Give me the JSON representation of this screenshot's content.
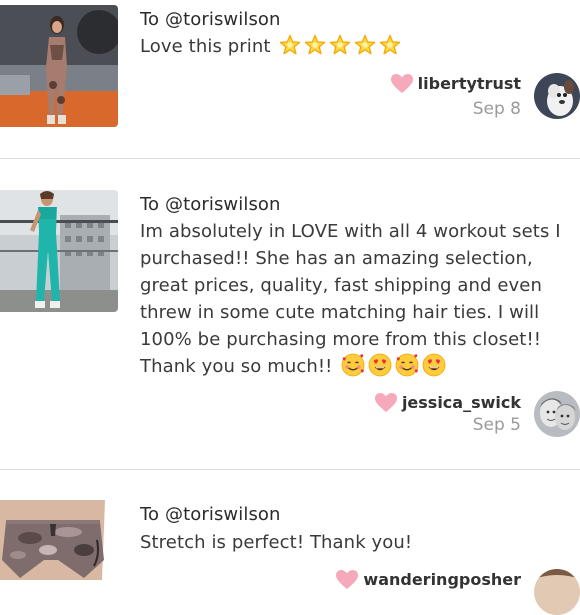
{
  "reviews": [
    {
      "to": "To @toriswilson",
      "text": "Love this print",
      "emoji": [
        "star-emoji",
        "star-emoji",
        "star-emoji",
        "star-emoji",
        "star-emoji"
      ],
      "user": "libertytrust",
      "date": "Sep 8"
    },
    {
      "to": "To @toriswilson",
      "text": "Im absolutely in LOVE with all 4 workout sets I purchased!! She has an amazing selection, great prices, quality, fast shipping and even threw in some cute matching hair ties. I will 100% be purchasing more from this closet!! Thank you so much!!",
      "emoji": [
        "smiling-face-with-hearts-emoji",
        "heart-eyes-emoji",
        "smiling-face-with-hearts-emoji",
        "heart-eyes-emoji"
      ],
      "user": "jessica_swick",
      "date": "Sep 5"
    },
    {
      "to": "To @toriswilson",
      "text": "Stretch is perfect! Thank you!",
      "user": "wanderingposher"
    }
  ],
  "colors": {
    "heart": "#f6a9bb",
    "date": "#9a9a9a",
    "divider": "#dddddd"
  }
}
